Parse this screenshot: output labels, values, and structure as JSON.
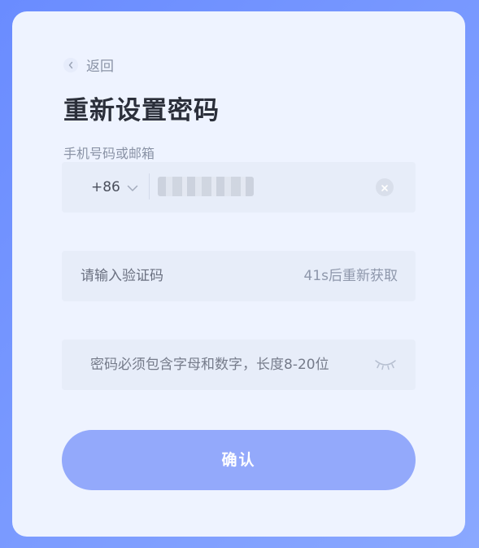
{
  "header": {
    "back_label": "返回",
    "title": "重新设置密码"
  },
  "phone_field": {
    "label": "手机号码或邮箱",
    "country_code": "+86"
  },
  "code_field": {
    "placeholder": "请输入验证码",
    "resend_label": "41s后重新获取"
  },
  "password_field": {
    "placeholder": "密码必须包含字母和数字，长度8-20位"
  },
  "confirm_button": {
    "label": "确认"
  },
  "colors": {
    "background": "#6a8cff",
    "card": "#eef3ff",
    "field": "#e7edf9",
    "button": "#93a9fb"
  },
  "icons": {
    "back": "chevron-left-icon",
    "dropdown": "chevron-down-icon",
    "clear": "clear-circle-icon",
    "password_visibility": "eye-closed-icon"
  }
}
